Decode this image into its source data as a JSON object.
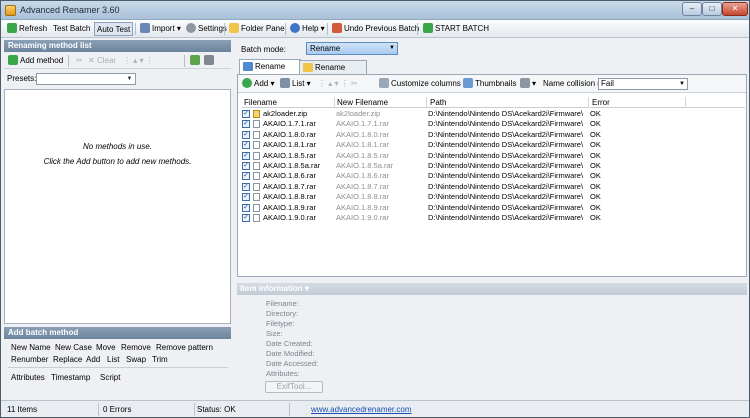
{
  "window": {
    "title": "Advanced Renamer 3.60"
  },
  "toolbar": {
    "refresh": "Refresh",
    "test_batch": "Test Batch",
    "auto_test": "Auto Test",
    "import": "Import",
    "settings": "Settings",
    "folder_panel": "Folder Panel",
    "help": "Help",
    "undo": "Undo Previous Batch",
    "start": "START BATCH"
  },
  "left_panel": {
    "header": "Renaming method list",
    "add_method": "Add method",
    "clear": "Clear",
    "presets_label": "Presets:",
    "presets_value": "",
    "empty_msg1": "No methods in use.",
    "empty_msg2": "Click the Add button to add new methods."
  },
  "add_batch_method": {
    "header": "Add batch method",
    "methods": [
      "New Name",
      "New Case",
      "Move",
      "Remove",
      "Remove pattern",
      "Renumber",
      "Replace",
      "Add",
      "List",
      "Swap",
      "Trim",
      "Attributes",
      "Timestamp",
      "Script"
    ]
  },
  "batch": {
    "label": "Batch mode:",
    "value": "Rename"
  },
  "tabs": [
    "Rename Files",
    "Rename Folders"
  ],
  "file_tools": {
    "add": "Add",
    "list": "List",
    "customize": "Customize columns",
    "thumbnails": "Thumbnails",
    "ncr_label": "Name collision rule:",
    "ncr_value": "Fail"
  },
  "columns": [
    "Filename",
    "New Filename",
    "Path",
    "Error"
  ],
  "files": [
    {
      "name": "ak2loader.zip",
      "new": "ak2loader.zip",
      "path": "D:\\Nintendo\\Nintendo DS\\Acekard2i\\Firmware\\",
      "error": "OK",
      "zip": true
    },
    {
      "name": "AKAIO.1.7.1.rar",
      "new": "AKAIO.1.7.1.rar",
      "path": "D:\\Nintendo\\Nintendo DS\\Acekard2i\\Firmware\\",
      "error": "OK"
    },
    {
      "name": "AKAIO.1.8.0.rar",
      "new": "AKAIO.1.8.0.rar",
      "path": "D:\\Nintendo\\Nintendo DS\\Acekard2i\\Firmware\\",
      "error": "OK"
    },
    {
      "name": "AKAIO.1.8.1.rar",
      "new": "AKAIO.1.8.1.rar",
      "path": "D:\\Nintendo\\Nintendo DS\\Acekard2i\\Firmware\\",
      "error": "OK"
    },
    {
      "name": "AKAIO.1.8.5.rar",
      "new": "AKAIO.1.8.5.rar",
      "path": "D:\\Nintendo\\Nintendo DS\\Acekard2i\\Firmware\\",
      "error": "OK"
    },
    {
      "name": "AKAIO.1.8.5a.rar",
      "new": "AKAIO.1.8.5a.rar",
      "path": "D:\\Nintendo\\Nintendo DS\\Acekard2i\\Firmware\\",
      "error": "OK"
    },
    {
      "name": "AKAIO.1.8.6.rar",
      "new": "AKAIO.1.8.6.rar",
      "path": "D:\\Nintendo\\Nintendo DS\\Acekard2i\\Firmware\\",
      "error": "OK"
    },
    {
      "name": "AKAIO.1.8.7.rar",
      "new": "AKAIO.1.8.7.rar",
      "path": "D:\\Nintendo\\Nintendo DS\\Acekard2i\\Firmware\\",
      "error": "OK"
    },
    {
      "name": "AKAIO.1.8.8.rar",
      "new": "AKAIO.1.8.8.rar",
      "path": "D:\\Nintendo\\Nintendo DS\\Acekard2i\\Firmware\\",
      "error": "OK"
    },
    {
      "name": "AKAIO.1.8.9.rar",
      "new": "AKAIO.1.8.9.rar",
      "path": "D:\\Nintendo\\Nintendo DS\\Acekard2i\\Firmware\\",
      "error": "OK"
    },
    {
      "name": "AKAIO.1.9.0.rar",
      "new": "AKAIO.1.9.0.rar",
      "path": "D:\\Nintendo\\Nintendo DS\\Acekard2i\\Firmware\\",
      "error": "OK"
    }
  ],
  "item_info": {
    "header": "Item information",
    "labels": [
      "Filename:",
      "Directory:",
      "Filetype:",
      "Size:",
      "Date Created:",
      "Date Modified:",
      "Date Accessed:",
      "Attributes:"
    ],
    "exif": "ExifTool..."
  },
  "status": {
    "items": "11 Items",
    "errors": "0 Errors",
    "status": "Status: OK",
    "link": "www.advancedrenamer.com"
  }
}
